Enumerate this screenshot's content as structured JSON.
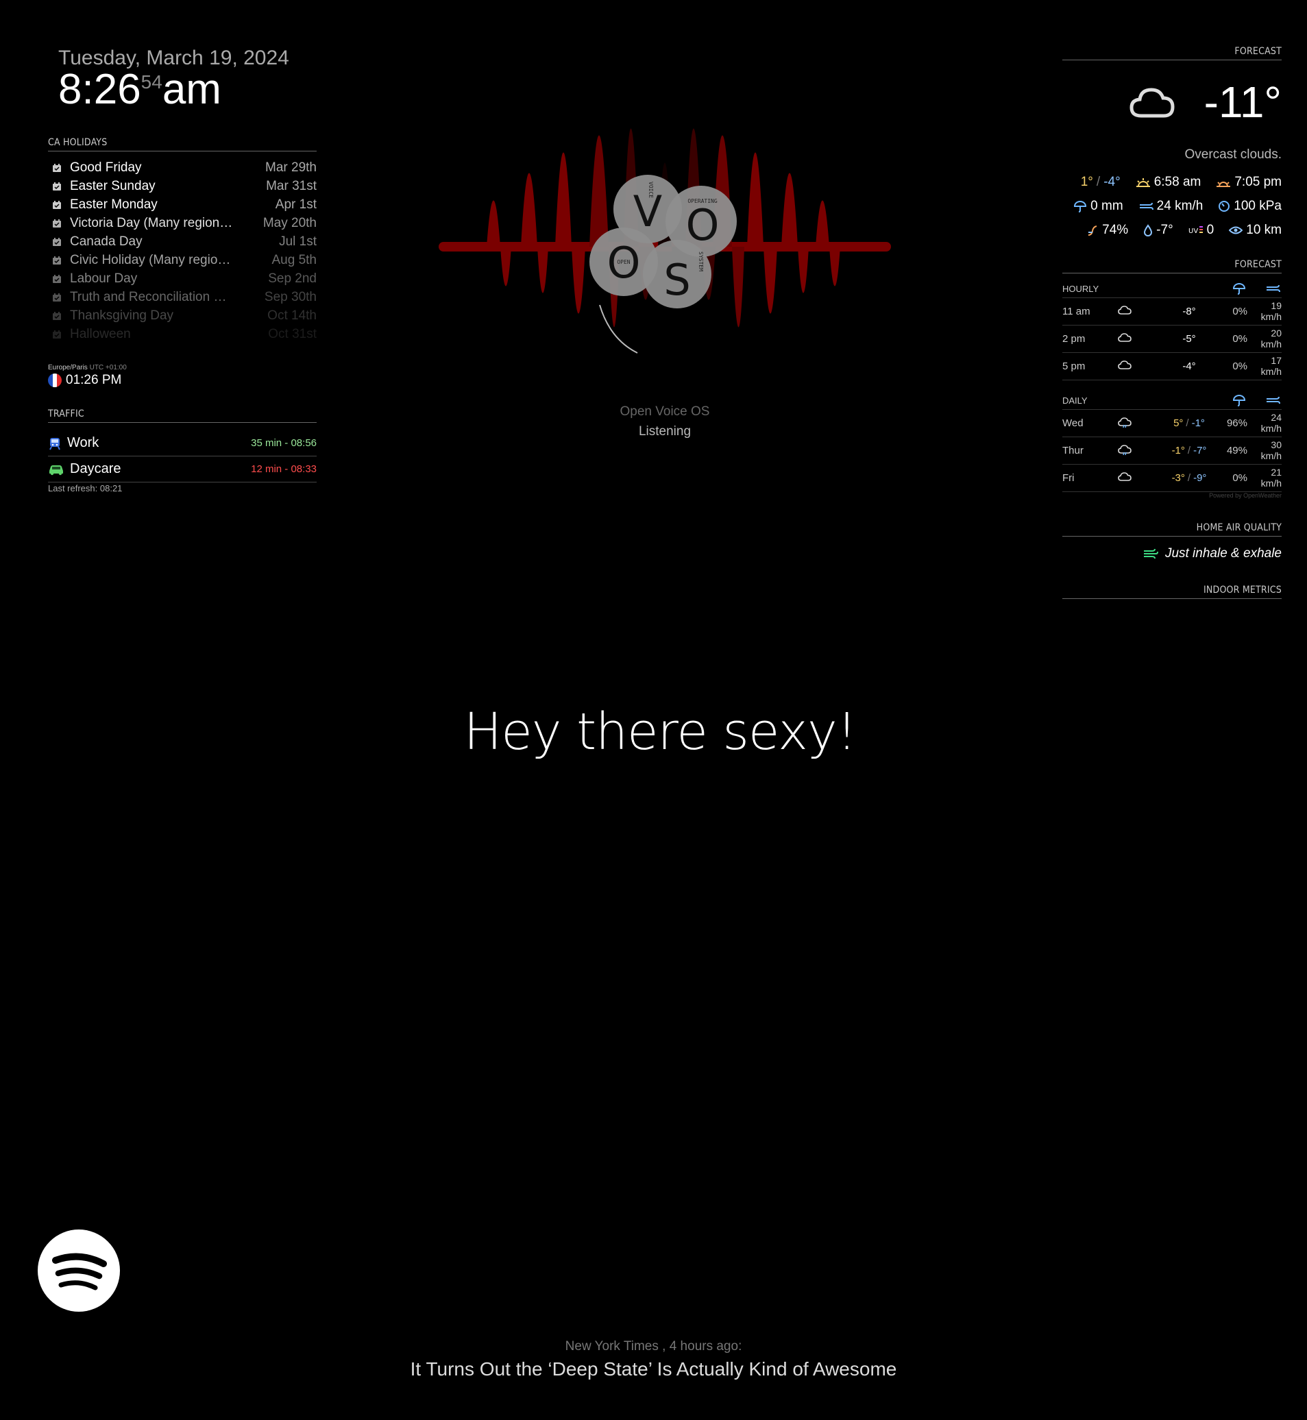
{
  "clock": {
    "date": "Tuesday, March 19, 2024",
    "hm": "8:26",
    "sec": "54",
    "ampm": "am"
  },
  "holidays": {
    "header": "CA HOLIDAYS",
    "items": [
      {
        "name": "Good Friday",
        "date": "Mar 29th"
      },
      {
        "name": "Easter Sunday",
        "date": "Mar 31st"
      },
      {
        "name": "Easter Monday",
        "date": "Apr 1st"
      },
      {
        "name": "Victoria Day (Many region…",
        "date": "May 20th"
      },
      {
        "name": "Canada Day",
        "date": "Jul 1st"
      },
      {
        "name": "Civic Holiday (Many regio…",
        "date": "Aug 5th"
      },
      {
        "name": "Labour Day",
        "date": "Sep 2nd"
      },
      {
        "name": "Truth and Reconciliation …",
        "date": "Sep 30th"
      },
      {
        "name": "Thanksgiving Day",
        "date": "Oct 14th"
      },
      {
        "name": "Halloween",
        "date": "Oct 31st"
      }
    ]
  },
  "worldclock": {
    "zone": "Europe/Paris",
    "offset": "UTC +01:00",
    "time": "01:26 PM"
  },
  "traffic": {
    "header": "TRAFFIC",
    "routes": [
      {
        "label": "Work",
        "eta": "35 min - 08:56",
        "color": "#9be89b"
      },
      {
        "label": "Daycare",
        "eta": "12 min - 08:33",
        "color": "#ff4d4d"
      }
    ],
    "refresh": "Last refresh: 08:21"
  },
  "ovos": {
    "title": "Open Voice OS",
    "status": "Listening",
    "logo_letters": {
      "v": "V",
      "o1": "O",
      "o2": "O",
      "s": "S",
      "voice": "VOICE",
      "operating": "OPERATING",
      "open": "OPEN",
      "system": "SYSTEM"
    }
  },
  "compliment": "Hey there sexy!",
  "weather": {
    "header": "FORECAST",
    "current": {
      "temp": "-11°",
      "desc": "Overcast clouds.",
      "hi": "1°",
      "lo": "-4°",
      "sunrise": "6:58 am",
      "sunset": "7:05 pm",
      "precip": "0 mm",
      "wind": "24 km/h",
      "pressure": "100 kPa",
      "humidity": "74%",
      "dew": "-7°",
      "uv": "0",
      "visibility": "10 km"
    },
    "forecast_header": "FORECAST",
    "hourly_label": "HOURLY",
    "hourly": [
      {
        "time": "11 am",
        "temp": "-8°",
        "pop": "0%",
        "wind_n": "19",
        "wind_u": "km/h"
      },
      {
        "time": "2 pm",
        "temp": "-5°",
        "pop": "0%",
        "wind_n": "20",
        "wind_u": "km/h"
      },
      {
        "time": "5 pm",
        "temp": "-4°",
        "pop": "0%",
        "wind_n": "17",
        "wind_u": "km/h"
      }
    ],
    "daily_label": "DAILY",
    "daily": [
      {
        "day": "Wed",
        "hi": "5°",
        "lo": "-1°",
        "pop": "96%",
        "wind_n": "24",
        "wind_u": "km/h"
      },
      {
        "day": "Thur",
        "hi": "-1°",
        "lo": "-7°",
        "pop": "49%",
        "wind_n": "30",
        "wind_u": "km/h"
      },
      {
        "day": "Fri",
        "hi": "-3°",
        "lo": "-9°",
        "pop": "0%",
        "wind_n": "21",
        "wind_u": "km/h"
      }
    ],
    "powered": "Powered by OpenWeather",
    "colors": {
      "warm": "#f7d26b",
      "cold": "#8ec5ff",
      "icon_blue": "#6fb7ff"
    }
  },
  "air": {
    "header": "HOME AIR QUALITY",
    "text": "Just inhale & exhale",
    "color": "#3ddc84"
  },
  "indoor": {
    "header": "INDOOR METRICS"
  },
  "news": {
    "source": "New York Times , 4 hours ago:",
    "headline": "It Turns Out the ‘Deep State’ Is Actually Kind of Awesome"
  }
}
